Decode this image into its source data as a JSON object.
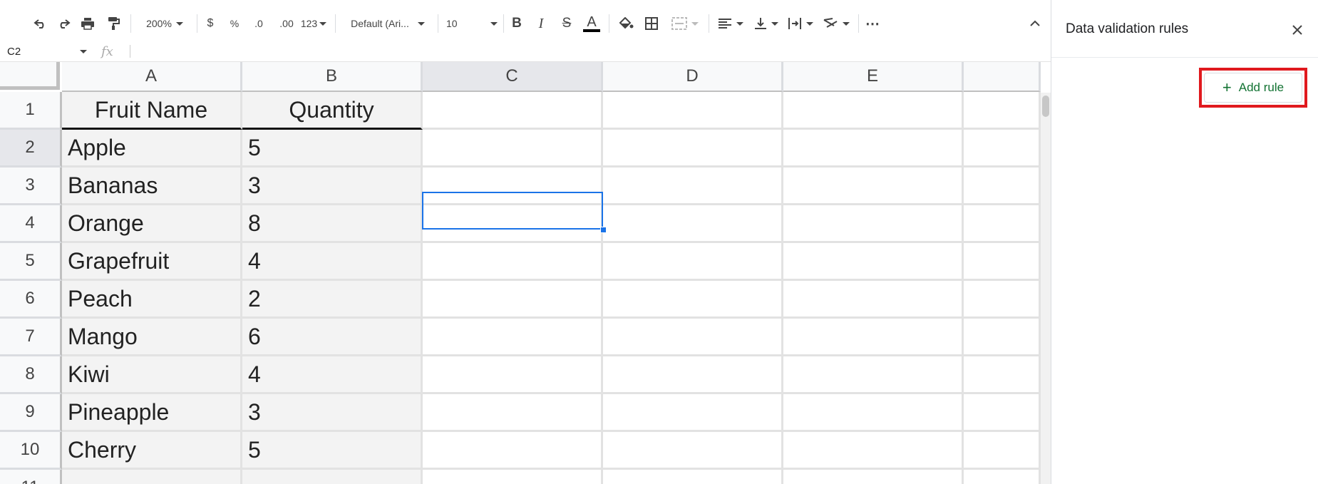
{
  "toolbar": {
    "zoom": "200%",
    "currency": "$",
    "percent": "%",
    "dec_decrease": ".0",
    "dec_increase": ".00",
    "number_format": "123",
    "font": "Default (Ari...",
    "font_size": "10",
    "bold": "B",
    "italic": "I",
    "strike": "S",
    "text_color": "A",
    "more": "⋯",
    "collapse": "⌃"
  },
  "formula": {
    "name_box": "C2",
    "fx": "fx",
    "value": ""
  },
  "columns": [
    "A",
    "B",
    "C",
    "D",
    "E"
  ],
  "rows": [
    {
      "n": "1",
      "a": "Fruit Name",
      "b": "Quantity"
    },
    {
      "n": "2",
      "a": "Apple",
      "b": "5"
    },
    {
      "n": "3",
      "a": "Bananas",
      "b": "3"
    },
    {
      "n": "4",
      "a": "Orange",
      "b": "8"
    },
    {
      "n": "5",
      "a": "Grapefruit",
      "b": "4"
    },
    {
      "n": "6",
      "a": "Peach",
      "b": "2"
    },
    {
      "n": "7",
      "a": "Mango",
      "b": "6"
    },
    {
      "n": "8",
      "a": "Kiwi",
      "b": "4"
    },
    {
      "n": "9",
      "a": "Pineapple",
      "b": "3"
    },
    {
      "n": "10",
      "a": "Cherry",
      "b": "5"
    },
    {
      "n": "11",
      "a": "",
      "b": ""
    }
  ],
  "sidepanel": {
    "title": "Data validation rules",
    "add_rule": "Add rule",
    "plus": "+"
  },
  "colors": {
    "accent": "#1a73e8",
    "highlight_red": "#e0191e",
    "add_green": "#137333"
  }
}
